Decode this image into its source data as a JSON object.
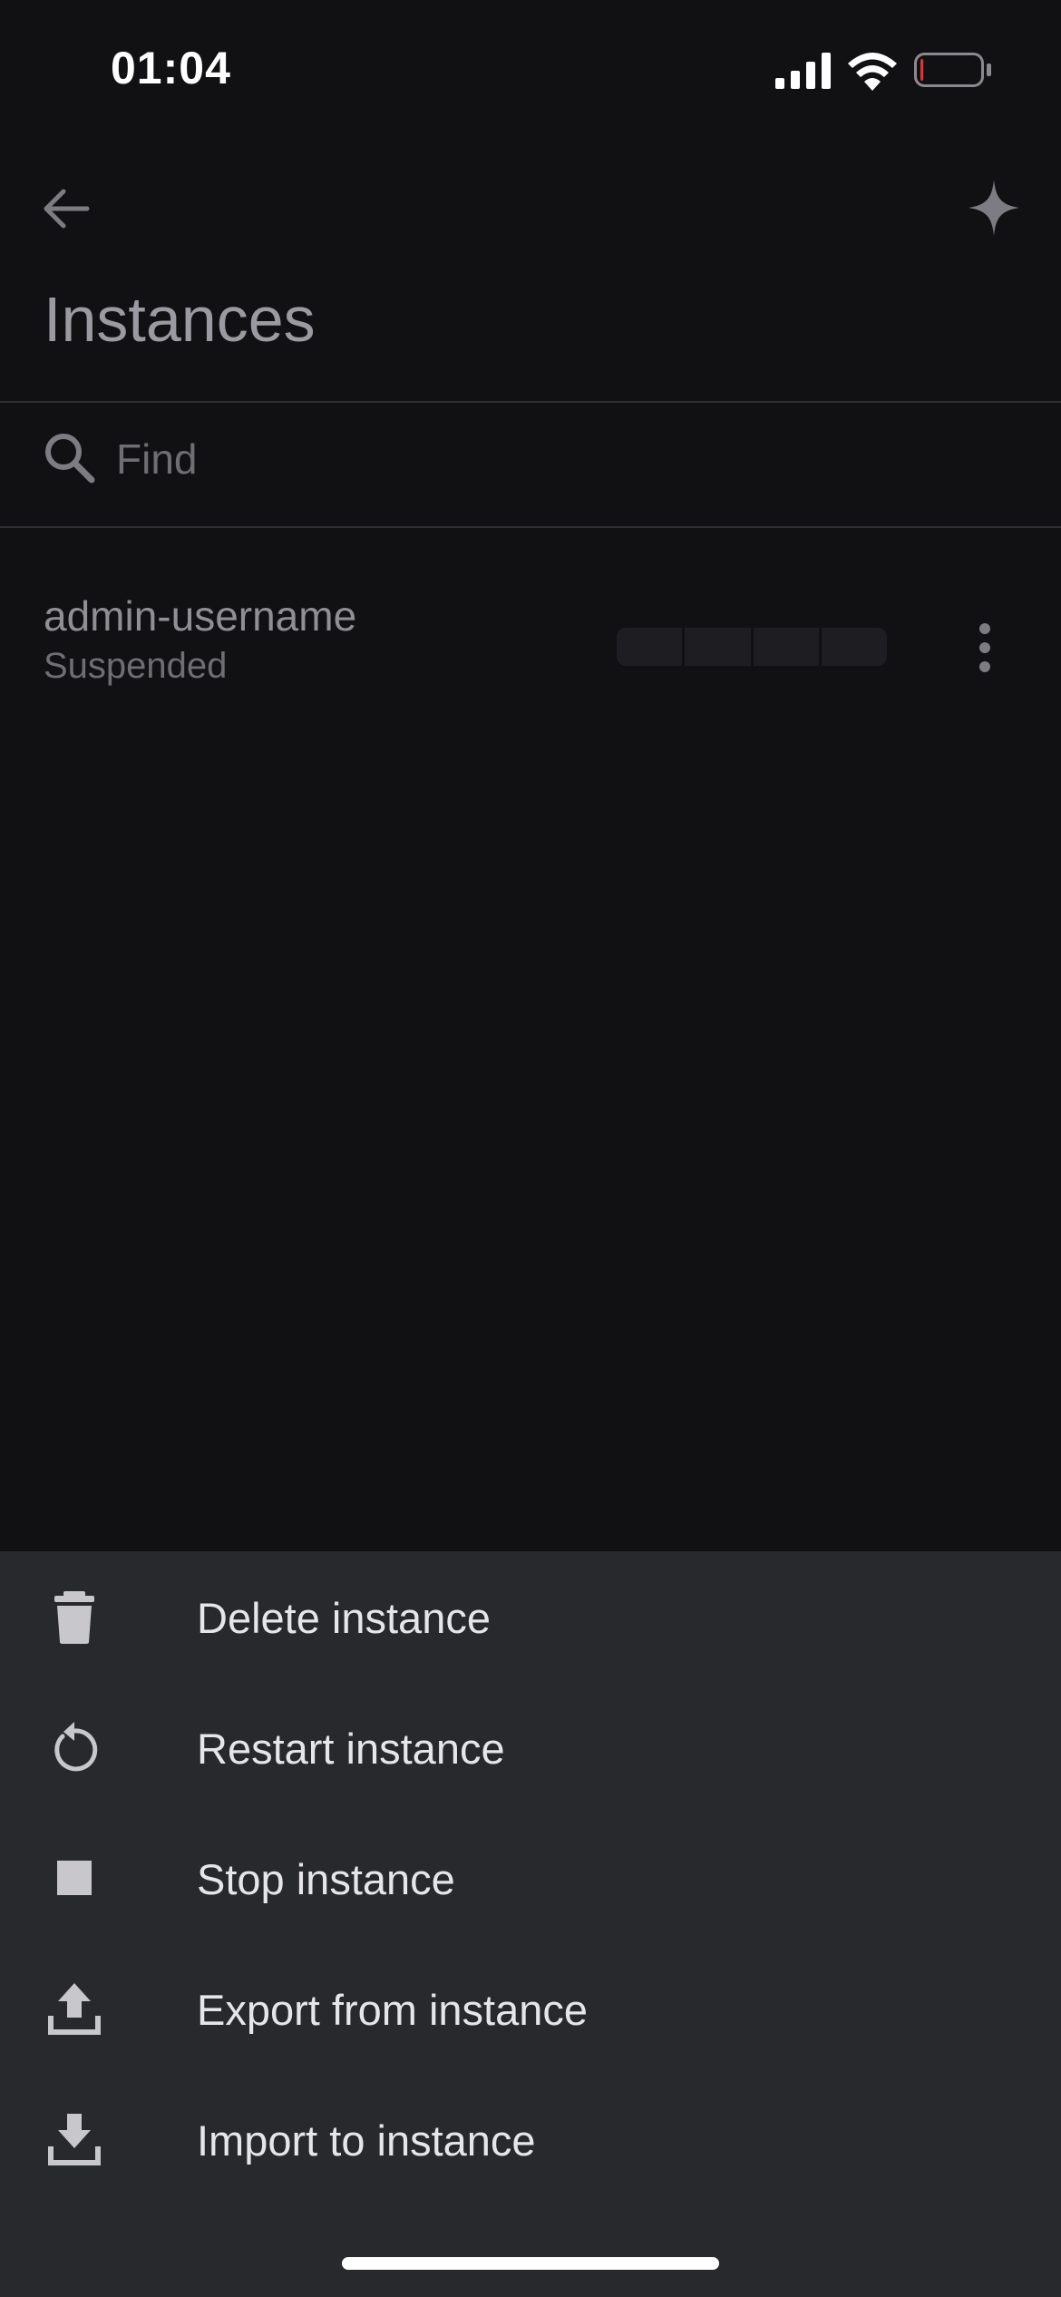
{
  "status_bar": {
    "time": "01:04",
    "signal_icon": "cellular-signal-icon",
    "wifi_icon": "wifi-icon",
    "battery_icon": "battery-low-icon",
    "battery_level_fraction": 0.05
  },
  "header": {
    "back_icon": "arrow-back-icon",
    "action_icon": "sparkle-icon",
    "title": "Instances"
  },
  "search": {
    "icon": "search-icon",
    "placeholder": "Find",
    "value": ""
  },
  "instances": [
    {
      "name": "admin-username",
      "status": "Suspended",
      "more_icon": "more-vert-icon"
    }
  ],
  "action_sheet": {
    "items": [
      {
        "label": "Delete instance",
        "icon": "trash-icon"
      },
      {
        "label": "Restart instance",
        "icon": "restart-icon"
      },
      {
        "label": "Stop instance",
        "icon": "stop-icon"
      },
      {
        "label": "Export from instance",
        "icon": "upload-icon"
      },
      {
        "label": "Import to instance",
        "icon": "download-icon"
      }
    ]
  },
  "colors": {
    "background": "#111114",
    "sheet_background": "#28292d",
    "sheet_text": "#e6e6ea",
    "dimmed_text": "#8f8f94",
    "battery_low": "#e0322f"
  }
}
